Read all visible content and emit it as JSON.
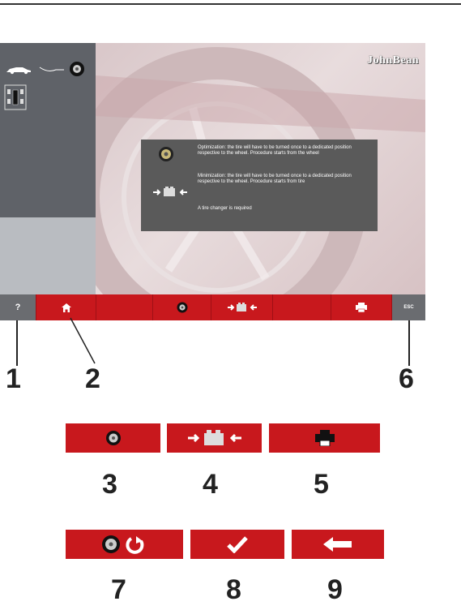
{
  "screen": {
    "logo": "JohnBean",
    "info": {
      "optimization": "Optimization: the tire will have to be turned once to a dedicated position respective to the wheel. Procedure starts from the wheel",
      "minimization": "Minimization: the tire will have to be turned once to a dedicated position respective to the wheel. Procedure starts from tire",
      "changer": "A tire changer is required"
    },
    "toolbar": {
      "help_label": "?",
      "esc_label": "ESC"
    }
  },
  "callouts": {
    "n1": "1",
    "n2": "2",
    "n3": "3",
    "n4": "4",
    "n5": "5",
    "n6": "6",
    "n7": "7",
    "n8": "8",
    "n9": "9"
  },
  "icons": {
    "home": "home-icon",
    "wheel": "wheel-icon",
    "arrows": "minimization-arrows-icon",
    "printer": "printer-icon",
    "rotate": "wheel-rotate-icon",
    "check": "check-icon",
    "back": "back-arrow-icon"
  },
  "colors": {
    "accent": "#c8181d",
    "sidebar": "#5f6268",
    "infobox": "#5a5a5a"
  }
}
